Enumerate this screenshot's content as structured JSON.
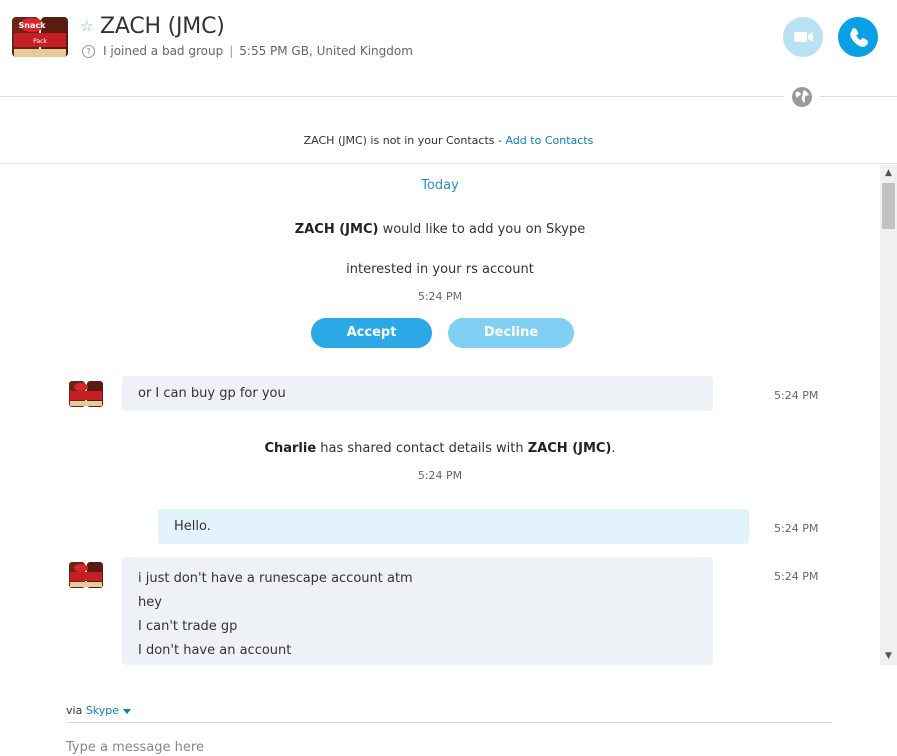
{
  "header": {
    "contact_name": "ZACH (JMC)",
    "mood": "I joined a bad group",
    "separator": "|",
    "local_time": "5:55 PM GB, United Kingdom",
    "icons": {
      "favorite": "star-outline-icon",
      "mood_help": "question-icon",
      "video": "video-camera-icon",
      "call": "phone-icon",
      "globe": "globe-icon"
    },
    "colors": {
      "call_button": "#0aa0e6",
      "video_button": "#b9e1f3"
    }
  },
  "notice": {
    "text": "ZACH (JMC) is not in your Contacts - ",
    "link": "Add to Contacts"
  },
  "conversation": {
    "date_label": "Today",
    "request": {
      "sender": "ZACH (JMC)",
      "text": " would like to add you on Skype",
      "message": "interested in your rs account",
      "time": "5:24 PM",
      "accept_label": "Accept",
      "decline_label": "Decline"
    },
    "msg1": {
      "text": "or I can buy gp for you",
      "time": "5:24 PM"
    },
    "shared": {
      "actor": "Charlie",
      "text": " has shared contact details with ",
      "target": "ZACH (JMC)",
      "end": ".",
      "time": "5:24 PM"
    },
    "msg2": {
      "text": "Hello.",
      "time": "5:24 PM"
    },
    "msg3": {
      "lines": [
        "i just don't have a runescape account atm",
        "hey",
        "I can't trade gp",
        "I don't have an account"
      ],
      "time": "5:24 PM"
    }
  },
  "footer": {
    "via_label": "via ",
    "via_service": "Skype",
    "input_placeholder": "Type a message here"
  }
}
